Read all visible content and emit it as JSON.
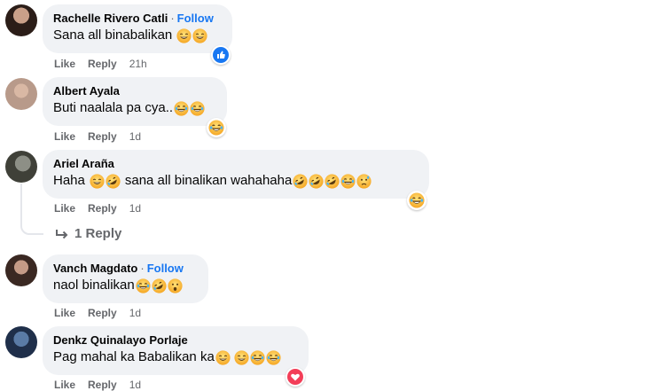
{
  "comments": [
    {
      "author": "Rachelle Rivero Catli",
      "follow": "Follow",
      "text": "Sana all binabalikan",
      "emojis": [
        "grin-sweat",
        "grin-sweat"
      ],
      "actions": {
        "like": "Like",
        "reply": "Reply",
        "time": "21h"
      },
      "reaction": "like-icon"
    },
    {
      "author": "Albert Ayala",
      "text": "Buti naalala pa cya..",
      "emojis": [
        "laugh-tears",
        "laugh-tears"
      ],
      "actions": {
        "like": "Like",
        "reply": "Reply",
        "time": "1d"
      },
      "reaction": "haha-icon"
    },
    {
      "author": "Ariel Araña",
      "text_a": "Haha",
      "text_b": "sana all binalikan wahahaha",
      "emojis_a": [
        "grin-sweat",
        "rofl"
      ],
      "emojis_b": [
        "rofl",
        "rofl",
        "rofl",
        "laugh-tears",
        "sad-sweat"
      ],
      "actions": {
        "like": "Like",
        "reply": "Reply",
        "time": "1d"
      },
      "reaction": "haha-icon",
      "replies": "1 Reply"
    },
    {
      "author": "Vanch Magdato",
      "follow": "Follow",
      "text": "naol binalikan",
      "emojis": [
        "crying-laugh",
        "rofl",
        "hushed"
      ],
      "actions": {
        "like": "Like",
        "reply": "Reply",
        "time": "1d"
      }
    },
    {
      "author": "Denkz Quinalayo Porlaje",
      "text": "Pag mahal ka Babalikan ka",
      "emojis": [
        "grin",
        "grin",
        "laugh-tears",
        "laugh-tears"
      ],
      "actions": {
        "like": "Like",
        "reply": "Reply",
        "time": "1d"
      },
      "reaction": "love-icon"
    }
  ],
  "colors": {
    "bubble": "#f0f2f5",
    "link": "#1877f2",
    "secondary": "#65676b",
    "emoji": "#f7b928"
  }
}
